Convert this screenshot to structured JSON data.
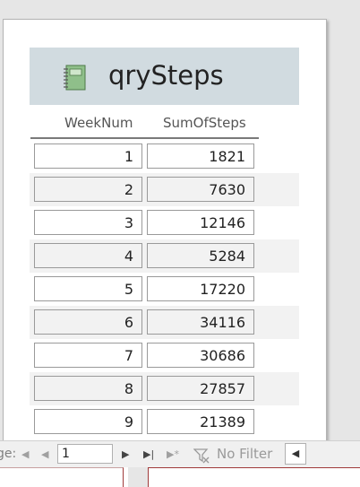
{
  "report": {
    "title": "qrySteps",
    "columns": [
      "WeekNum",
      "SumOfSteps"
    ],
    "rows": [
      {
        "week": "1",
        "steps": "1821"
      },
      {
        "week": "2",
        "steps": "7630"
      },
      {
        "week": "3",
        "steps": "12146"
      },
      {
        "week": "4",
        "steps": "5284"
      },
      {
        "week": "5",
        "steps": "17220"
      },
      {
        "week": "6",
        "steps": "34116"
      },
      {
        "week": "7",
        "steps": "30686"
      },
      {
        "week": "8",
        "steps": "27857"
      },
      {
        "week": "9",
        "steps": "21389"
      }
    ]
  },
  "status_bar": {
    "page_label": "ge:",
    "page_value": "1",
    "filter_label": "No Filter"
  },
  "colors": {
    "header_band": "#d1dbe0",
    "alt_row": "#f2f2f2",
    "accent_border": "#a03a3a"
  },
  "icons": {
    "report": "report-notebook-icon",
    "first": "first-page-icon",
    "prev": "previous-page-icon",
    "next": "next-page-icon",
    "last": "last-page-icon",
    "new": "new-record-icon",
    "filter": "filter-icon",
    "scroll": "scroll-left-icon"
  }
}
